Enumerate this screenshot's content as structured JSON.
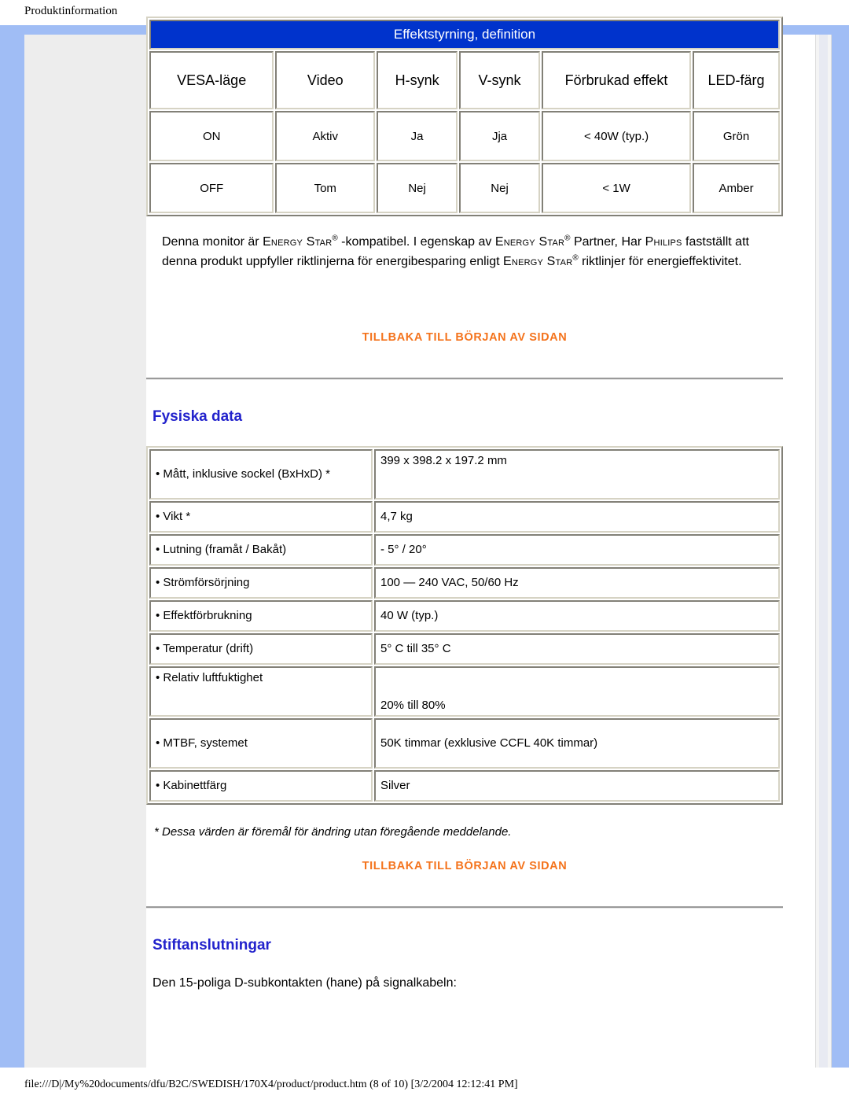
{
  "document": {
    "header_title": "Produktinformation",
    "status_path": "file:///D|/My%20documents/dfu/B2C/SWEDISH/170X4/product/product.htm (8 of 10) [3/2/2004 12:12:41 PM]"
  },
  "colors": {
    "table_header_blue": "#0033cc",
    "section_heading_blue": "#2222cc",
    "link_orange": "#f4731c",
    "page_surround_blue": "#a0bdf5",
    "side_column_gray": "#ededed"
  },
  "power_management": {
    "title": "Effektstyrning, definition",
    "columns": [
      "VESA-läge",
      "Video",
      "H-synk",
      "V-synk",
      "Förbrukad effekt",
      "LED-färg"
    ],
    "rows": [
      [
        "ON",
        "Aktiv",
        "Ja",
        "Jja",
        "< 40W (typ.)",
        "Grön"
      ],
      [
        "OFF",
        "Tom",
        "Nej",
        "Nej",
        "< 1W",
        "Amber"
      ]
    ]
  },
  "energy_star": {
    "p1_a": "Denna monitor är ",
    "p1_es1": "Energy Star",
    "p1_b": " -kompatibel. I egenskap av ",
    "p1_es2": "Energy Star",
    "p1_c": " Partner, Har ",
    "p1_philips": "Philips",
    "p1_d": " fastställt att denna produkt uppfyller riktlinjerna för energibesparing enligt ",
    "p1_es3": "Energy Star",
    "p1_e": " riktlinjer för energieffektivitet.",
    "registered_mark": "®"
  },
  "links": {
    "back_to_top_1": "TILLBAKA TILL BÖRJAN AV SIDAN",
    "back_to_top_2": "TILLBAKA TILL BÖRJAN AV SIDAN"
  },
  "physical_data": {
    "heading": "Fysiska data",
    "rows": [
      {
        "label": "• Mått, inklusive sockel (BxHxD) *",
        "value": "399 x 398.2 x 197.2 mm"
      },
      {
        "label": "• Vikt *",
        "value": "4,7 kg"
      },
      {
        "label": "• Lutning (framåt / Bakåt)",
        "value": "- 5° / 20°"
      },
      {
        "label": "• Strömförsörjning",
        "value": "100 — 240 VAC, 50/60 Hz"
      },
      {
        "label": "• Effektförbrukning",
        "value": "40 W (typ.)"
      },
      {
        "label": "• Temperatur (drift)",
        "value": "5° C till 35° C"
      },
      {
        "label": "• Relativ luftfuktighet",
        "value": "20% till 80%"
      },
      {
        "label": "• MTBF, systemet",
        "value": "50K timmar (exklusive CCFL 40K timmar)"
      },
      {
        "label": "• Kabinettfärg",
        "value": "Silver"
      }
    ],
    "footnote": "* Dessa värden är föremål för ändring utan föregående meddelande."
  },
  "pin_assignments": {
    "heading": "Stiftanslutningar",
    "text": "Den 15-poliga D-subkontakten (hane) på signalkabeln:"
  }
}
